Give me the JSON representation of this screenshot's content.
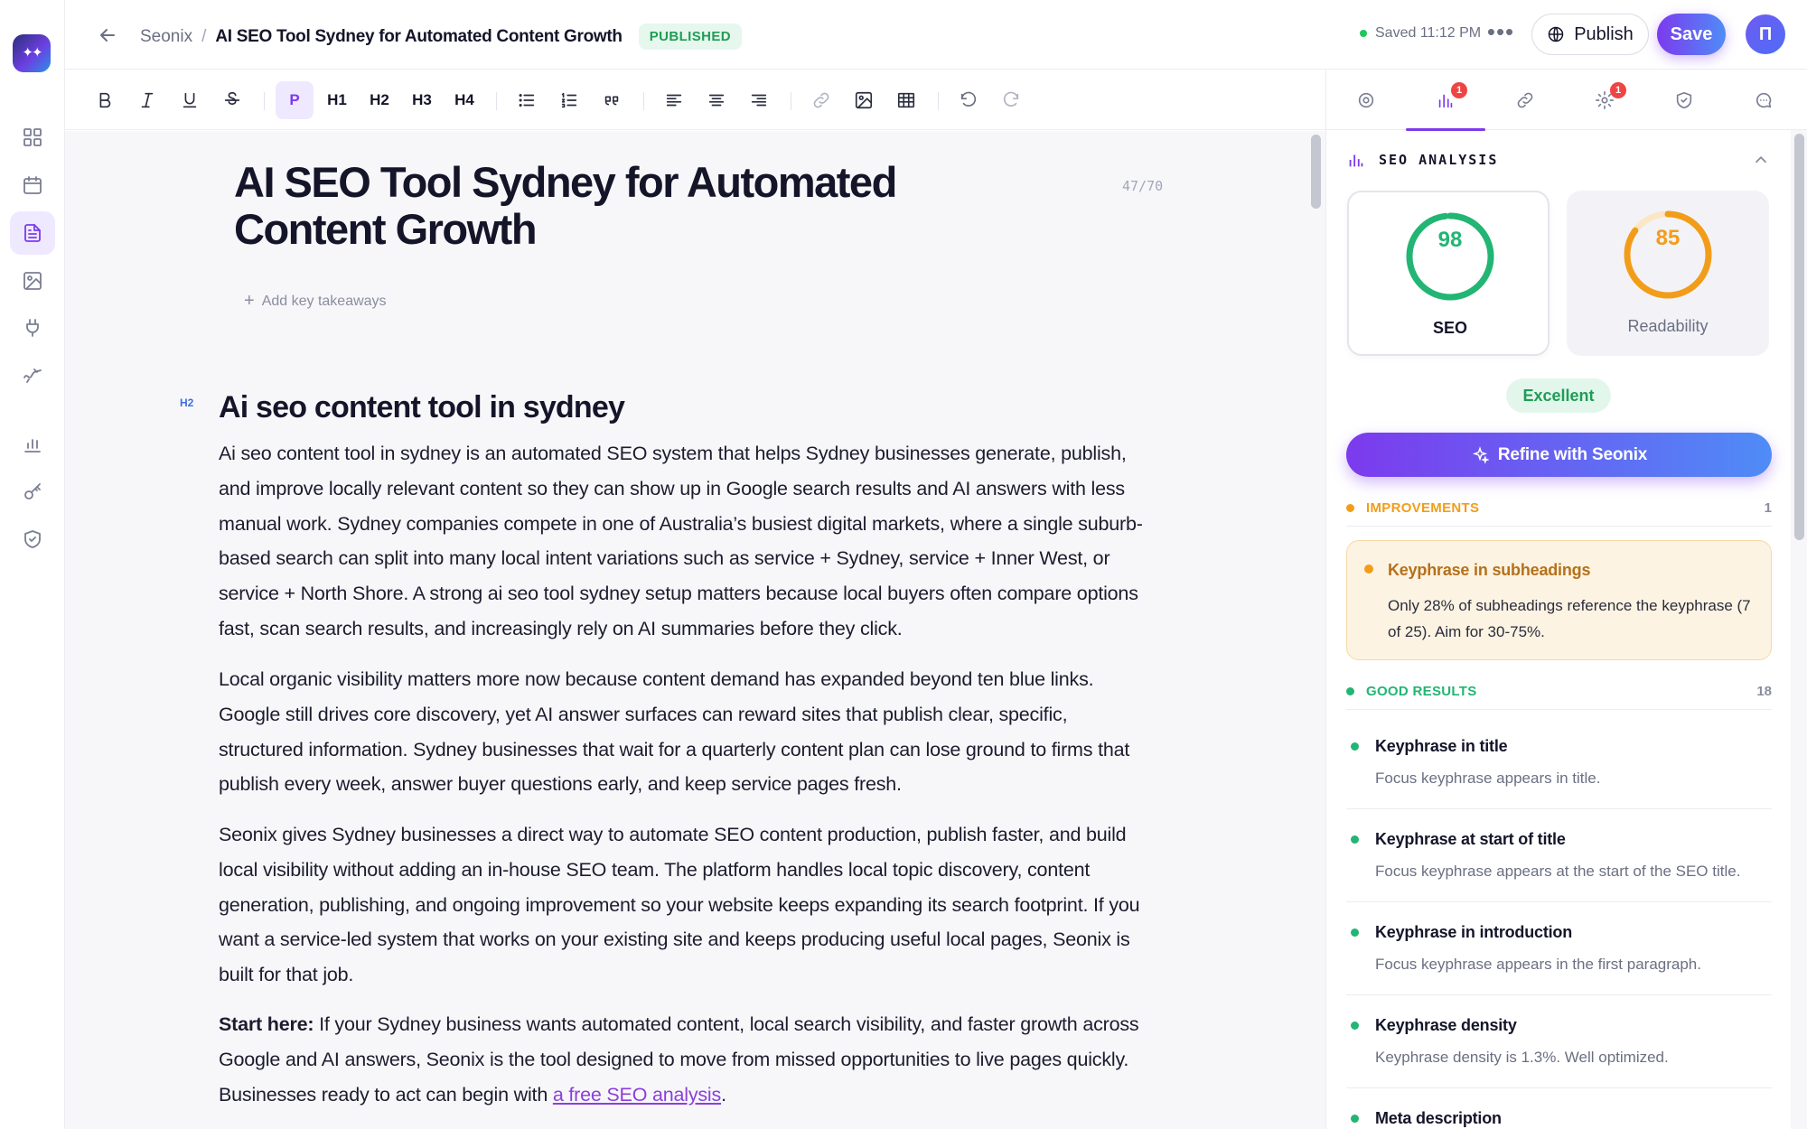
{
  "nav": {
    "items": [
      {
        "name": "dashboard-icon"
      },
      {
        "name": "calendar-icon"
      },
      {
        "name": "document-icon",
        "active": true
      },
      {
        "name": "image-icon"
      },
      {
        "name": "plug-icon"
      },
      {
        "name": "sparkline-icon"
      },
      {
        "name": "bar-chart-icon"
      },
      {
        "name": "key-icon"
      },
      {
        "name": "shield-icon"
      }
    ]
  },
  "header": {
    "breadcrumb_root": "Seonix",
    "breadcrumb_sep": "/",
    "breadcrumb_current": "AI SEO Tool Sydney for Automated Content Growth",
    "status_badge": "PUBLISHED",
    "saved_text": "Saved 11:12 PM",
    "more_label": "•••",
    "publish_label": "Publish",
    "save_label": "Save",
    "avatar_initial": "П"
  },
  "toolbar": {
    "paragraph_label": "P",
    "h1_label": "H1",
    "h2_label": "H2",
    "h3_label": "H3",
    "h4_label": "H4",
    "active": "P"
  },
  "editor": {
    "title": "AI SEO Tool Sydney for Automated Content Growth",
    "title_count": "47/70",
    "add_takeaways": "Add key takeaways",
    "h2_tag": "H2",
    "h2_text": "Ai seo content tool in sydney",
    "paragraphs": [
      "Ai seo content tool in sydney is an automated SEO system that helps Sydney businesses generate, publish, and improve locally relevant content so they can show up in Google search results and AI answers with less manual work. Sydney companies compete in one of Australia’s busiest digital markets, where a single suburb-based search can split into many local intent variations such as service + Sydney, service + Inner West, or service + North Shore. A strong ai seo tool sydney setup matters because local buyers often compare options fast, scan search results, and increasingly rely on AI summaries before they click.",
      "Local organic visibility matters more now because content demand has expanded beyond ten blue links. Google still drives core discovery, yet AI answer surfaces can reward sites that publish clear, specific, structured information. Sydney businesses that wait for a quarterly content plan can lose ground to firms that publish every week, answer buyer questions early, and keep service pages fresh.",
      "Seonix gives Sydney businesses a direct way to automate SEO content production, publish faster, and build local visibility without adding an in-house SEO team. The platform handles local topic discovery, content generation, publishing, and ongoing improvement so your website keeps expanding its search footprint. If you want a service-led system that works on your existing site and keeps producing useful local pages, Seonix is built for that job."
    ],
    "cta_bold": "Start here:",
    "cta_text": " If your Sydney business wants automated content, local search visibility, and faster growth across Google and AI answers, Seonix is the tool designed to move from missed opportunities to live pages quickly. Businesses ready to act can begin with ",
    "cta_link": "a free SEO analysis",
    "cta_end": "."
  },
  "panel": {
    "tabs": [
      {
        "name": "target-icon"
      },
      {
        "name": "seo-analysis-icon",
        "badge": "1",
        "active": true
      },
      {
        "name": "link-icon"
      },
      {
        "name": "settings-icon",
        "badge": "1"
      },
      {
        "name": "shield-check-icon"
      },
      {
        "name": "comment-icon"
      }
    ],
    "section_title": "SEO ANALYSIS",
    "seo_score": 98,
    "seo_label": "SEO",
    "readability_score": 85,
    "readability_label": "Readability",
    "rating": "Excellent",
    "refine_label": "Refine with Seonix",
    "improvements_label": "IMPROVEMENTS",
    "improvements_count": "1",
    "improvement": {
      "title": "Keyphrase in subheadings",
      "desc": "Only 28% of subheadings reference the keyphrase (7 of 25). Aim for 30-75%."
    },
    "good_label": "GOOD RESULTS",
    "good_count": "18",
    "results": [
      {
        "title": "Keyphrase in title",
        "desc": "Focus keyphrase appears in title."
      },
      {
        "title": "Keyphrase at start of title",
        "desc": "Focus keyphrase appears at the start of the SEO title."
      },
      {
        "title": "Keyphrase in introduction",
        "desc": "Focus keyphrase appears in the first paragraph."
      },
      {
        "title": "Keyphrase density",
        "desc": "Keyphrase density is 1.3%. Well optimized."
      },
      {
        "title": "Meta description",
        "desc": ""
      }
    ]
  },
  "colors": {
    "accent": "#7c3aed",
    "seo_green": "#22b573",
    "readability_orange": "#f29d1a",
    "published_green": "#1f9d55"
  }
}
